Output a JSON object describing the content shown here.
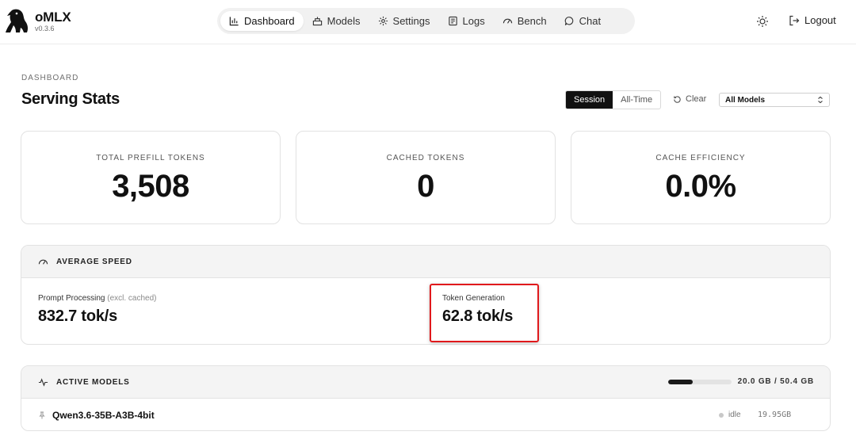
{
  "app": {
    "name": "oMLX",
    "version": "v0.3.6"
  },
  "nav": {
    "items": [
      {
        "label": "Dashboard",
        "icon": "bar-chart-icon",
        "active": true
      },
      {
        "label": "Models",
        "icon": "box-icon",
        "active": false
      },
      {
        "label": "Settings",
        "icon": "gear-icon",
        "active": false
      },
      {
        "label": "Logs",
        "icon": "logs-icon",
        "active": false
      },
      {
        "label": "Bench",
        "icon": "gauge-icon",
        "active": false
      },
      {
        "label": "Chat",
        "icon": "chat-icon",
        "active": false
      }
    ],
    "theme_icon": "sun-icon",
    "logout_label": "Logout"
  },
  "header": {
    "eyebrow": "DASHBOARD",
    "title": "Serving Stats",
    "range_options": [
      "Session",
      "All-Time"
    ],
    "range_selected": "Session",
    "clear_label": "Clear",
    "model_filter": "All Models"
  },
  "stats": [
    {
      "label": "TOTAL PREFILL TOKENS",
      "value": "3,508"
    },
    {
      "label": "CACHED TOKENS",
      "value": "0"
    },
    {
      "label": "CACHE EFFICIENCY",
      "value": "0.0%"
    }
  ],
  "speed": {
    "title": "AVERAGE SPEED",
    "prompt_label": "Prompt Processing",
    "prompt_note": "(excl. cached)",
    "prompt_value": "832.7 tok/s",
    "gen_label": "Token Generation",
    "gen_value": "62.8 tok/s"
  },
  "active_models": {
    "title": "ACTIVE MODELS",
    "memory_text": "20.0 GB / 50.4 GB",
    "memory_fraction": 0.397,
    "rows": [
      {
        "name": "Qwen3.6-35B-A3B-4bit",
        "status": "idle",
        "size": "19.95GB"
      }
    ]
  },
  "colors": {
    "accent": "#111111",
    "highlight": "#e0191c",
    "panel_head": "#f4f4f4"
  }
}
